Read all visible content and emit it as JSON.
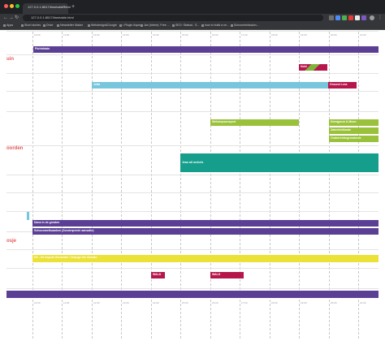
{
  "browser": {
    "tab_title": "127.0.0.1:8517/timetable.html",
    "url": "127.0.0.1:8517/timetable.html",
    "new_tab": "+",
    "tab_close": "×",
    "bookmarks": [
      "Apps",
      "Short stories",
      "Drive",
      "Newsletter Maker",
      "Webdesign&Google",
      "• Plugin Aspect",
      "Jan (Intern): Free ...",
      "SEO: Statsat - S...",
      "how to build a ne...",
      "Schoonheidsalon..."
    ]
  },
  "timetable": {
    "time_labels": [
      "10:00",
      "11:00",
      "12:00",
      "13:00",
      "14:00",
      "15:00",
      "16:00",
      "17:00",
      "18:00",
      "19:00",
      "20:00",
      "21:00",
      "22:00"
    ],
    "stages": [
      "uin",
      "oorden",
      "osje"
    ],
    "bars": [
      {
        "label": "Plohtridain",
        "color": "#5b3f95"
      },
      {
        "label": "Nobi",
        "color": "#b5174b"
      },
      {
        "label": "Jetta",
        "color": "#78c6dc"
      },
      {
        "label": "Ground Less",
        "color": "#b5174b"
      },
      {
        "label": "Welsimpsonsport",
        "color": "#99c13a"
      },
      {
        "label": "Kiemjpeun & Moon",
        "color": "#99c13a"
      },
      {
        "label": "Zaterlichtlunde",
        "color": "#99c13a"
      },
      {
        "label": "Onderrehtregronderde",
        "color": "#99c13a"
      },
      {
        "label": "Jean all orchels",
        "color": "#169e8c"
      },
      {
        "label": "Dans in de greaten",
        "color": "#5b3f95"
      },
      {
        "label": "Schoonmelkuanken (Zonderpende aansalte)",
        "color": "#5b3f95"
      },
      {
        "label": "DX - De Impuls Generatie / Change the Climate",
        "color": "#ebe137"
      },
      {
        "label": "WALD",
        "color": "#b5174b"
      },
      {
        "label": "WALD",
        "color": "#b5174b"
      },
      {
        "label": "",
        "color": "#5b3f95"
      }
    ]
  }
}
